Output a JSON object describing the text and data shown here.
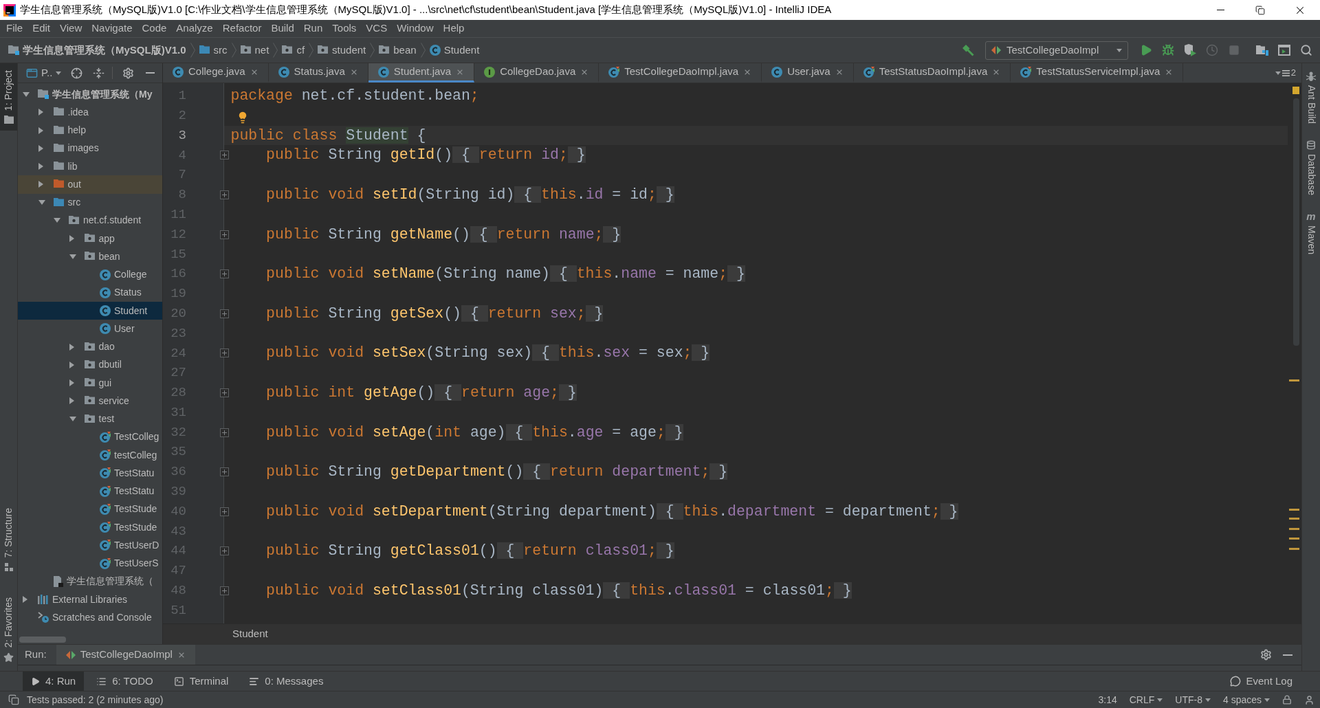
{
  "window": {
    "title": "学生信息管理系统（MySQL版)V1.0 [C:\\作业文档\\学生信息管理系统（MySQL版)V1.0] - ...\\src\\net\\cf\\student\\bean\\Student.java [学生信息管理系统（MySQL版)V1.0] - IntelliJ IDEA"
  },
  "menu": [
    "File",
    "Edit",
    "View",
    "Navigate",
    "Code",
    "Analyze",
    "Refactor",
    "Build",
    "Run",
    "Tools",
    "VCS",
    "Window",
    "Help"
  ],
  "navbar": {
    "breadcrumbs": [
      {
        "kind": "project",
        "label": "学生信息管理系统（MySQL版)V1.0"
      },
      {
        "kind": "source_folder",
        "label": "src"
      },
      {
        "kind": "package",
        "label": "net"
      },
      {
        "kind": "package",
        "label": "cf"
      },
      {
        "kind": "package",
        "label": "student"
      },
      {
        "kind": "package",
        "label": "bean"
      },
      {
        "kind": "class",
        "label": "Student"
      }
    ],
    "toolbar": [
      {
        "kind": "build",
        "disabled": false
      },
      {
        "kind": "run_config",
        "label": "TestCollegeDaoImpl"
      },
      {
        "kind": "run",
        "disabled": false
      },
      {
        "kind": "debug",
        "disabled": false
      },
      {
        "kind": "coverage",
        "disabled": false
      },
      {
        "kind": "profile",
        "disabled": true
      },
      {
        "kind": "stop",
        "disabled": true
      },
      {
        "kind": "project_structure",
        "disabled": false
      },
      {
        "kind": "layout",
        "disabled": false
      },
      {
        "kind": "search",
        "disabled": false
      }
    ]
  },
  "left_strip": {
    "top": [
      {
        "label": "1: Project",
        "kind": "project",
        "selected": true
      }
    ],
    "bottom": [
      {
        "label": "7: Structure",
        "kind": "structure",
        "selected": false
      },
      {
        "label": "2: Favorites",
        "kind": "favorites",
        "selected": false
      }
    ]
  },
  "project_panel": {
    "view": "P..",
    "tree": [
      {
        "label": "学生信息管理系统（My",
        "kind": "project",
        "expanded": true,
        "selected": false,
        "children": [
          {
            "label": ".idea",
            "kind": "folder",
            "expanded": false,
            "selected": false
          },
          {
            "label": "help",
            "kind": "folder",
            "expanded": false,
            "selected": false
          },
          {
            "label": "images",
            "kind": "folder",
            "expanded": false,
            "selected": false
          },
          {
            "label": "lib",
            "kind": "folder",
            "expanded": false,
            "selected": false
          },
          {
            "label": "out",
            "kind": "excluded_folder",
            "expanded": false,
            "selected": false
          },
          {
            "label": "src",
            "kind": "source_folder",
            "expanded": true,
            "selected": false,
            "children": [
              {
                "label": "net.cf.student",
                "kind": "package",
                "expanded": true,
                "selected": false,
                "children": [
                  {
                    "label": "app",
                    "kind": "package",
                    "expanded": false,
                    "selected": false
                  },
                  {
                    "label": "bean",
                    "kind": "package",
                    "expanded": true,
                    "selected": false,
                    "children": [
                      {
                        "label": "College",
                        "kind": "class",
                        "selected": false
                      },
                      {
                        "label": "Status",
                        "kind": "class",
                        "selected": false
                      },
                      {
                        "label": "Student",
                        "kind": "class",
                        "selected": true
                      },
                      {
                        "label": "User",
                        "kind": "class",
                        "selected": false
                      }
                    ]
                  },
                  {
                    "label": "dao",
                    "kind": "package",
                    "expanded": false,
                    "selected": false
                  },
                  {
                    "label": "dbutil",
                    "kind": "package",
                    "expanded": false,
                    "selected": false
                  },
                  {
                    "label": "gui",
                    "kind": "package",
                    "expanded": false,
                    "selected": false
                  },
                  {
                    "label": "service",
                    "kind": "package",
                    "expanded": false,
                    "selected": false
                  },
                  {
                    "label": "test",
                    "kind": "package",
                    "expanded": true,
                    "selected": false,
                    "children": [
                      {
                        "label": "TestColleg",
                        "kind": "test",
                        "selected": false
                      },
                      {
                        "label": "testColleg",
                        "kind": "test",
                        "selected": false
                      },
                      {
                        "label": "TestStatu",
                        "kind": "test",
                        "selected": false
                      },
                      {
                        "label": "TestStatu",
                        "kind": "test",
                        "selected": false
                      },
                      {
                        "label": "TestStude",
                        "kind": "test",
                        "selected": false
                      },
                      {
                        "label": "TestStude",
                        "kind": "test",
                        "selected": false
                      },
                      {
                        "label": "TestUserD",
                        "kind": "test",
                        "selected": false
                      },
                      {
                        "label": "TestUserS",
                        "kind": "test",
                        "selected": false
                      }
                    ]
                  }
                ]
              }
            ]
          },
          {
            "label": "学生信息管理系统（",
            "kind": "module_file",
            "selected": false
          }
        ]
      },
      {
        "label": "External Libraries",
        "kind": "libraries",
        "expanded": false,
        "selected": false
      },
      {
        "label": "Scratches and Console",
        "kind": "scratches",
        "selected": false
      }
    ]
  },
  "tabs": [
    {
      "label": "College.java",
      "kind": "class",
      "selected": false
    },
    {
      "label": "Status.java",
      "kind": "class",
      "selected": false
    },
    {
      "label": "Student.java",
      "kind": "class",
      "selected": true
    },
    {
      "label": "CollegeDao.java",
      "kind": "interface",
      "selected": false
    },
    {
      "label": "TestCollegeDaoImpl.java",
      "kind": "test",
      "selected": false
    },
    {
      "label": "User.java",
      "kind": "class",
      "selected": false
    },
    {
      "label": "TestStatusDaoImpl.java",
      "kind": "test",
      "selected": false
    },
    {
      "label": "TestStatusServiceImpl.java",
      "kind": "test",
      "selected": false
    }
  ],
  "hidden_tab_count": "2",
  "editor": {
    "lines": [
      {
        "number": "1",
        "current": false,
        "folded": false,
        "bulb": false,
        "tokens": [
          {
            "kind": "keyword",
            "text": "package "
          },
          {
            "kind": "plain",
            "text": "net.cf.student.bean"
          },
          {
            "kind": "keyword",
            "text": ";"
          }
        ]
      },
      {
        "number": "2",
        "current": false,
        "folded": false,
        "bulb": true
      },
      {
        "number": "3",
        "current": true,
        "folded": false,
        "bulb": false,
        "tokens": [
          {
            "kind": "keyword",
            "text": "public class "
          },
          {
            "kind": "usage",
            "text": "Student"
          },
          {
            "kind": "plain",
            "text": " {"
          }
        ]
      },
      {
        "number": "4",
        "current": false,
        "folded": true,
        "bulb": false,
        "tokens": [
          {
            "kind": "keyword",
            "text": "    public "
          },
          {
            "kind": "plain",
            "text": "String "
          },
          {
            "kind": "method",
            "text": "getId"
          },
          {
            "kind": "plain",
            "text": "()"
          },
          {
            "kind": "fold",
            "text": " { "
          },
          {
            "kind": "keyword",
            "text": "return "
          },
          {
            "kind": "field",
            "text": "id"
          },
          {
            "kind": "keyword",
            "text": ";"
          },
          {
            "kind": "fold",
            "text": " }"
          }
        ]
      },
      {
        "number": "7",
        "current": false,
        "folded": false,
        "bulb": false
      },
      {
        "number": "8",
        "current": false,
        "folded": true,
        "bulb": false,
        "tokens": [
          {
            "kind": "keyword",
            "text": "    public void "
          },
          {
            "kind": "method",
            "text": "setId"
          },
          {
            "kind": "plain",
            "text": "(String id)"
          },
          {
            "kind": "fold",
            "text": " { "
          },
          {
            "kind": "keyword",
            "text": "this"
          },
          {
            "kind": "plain",
            "text": "."
          },
          {
            "kind": "field",
            "text": "id"
          },
          {
            "kind": "plain",
            "text": " = id"
          },
          {
            "kind": "keyword",
            "text": ";"
          },
          {
            "kind": "fold",
            "text": " }"
          }
        ]
      },
      {
        "number": "11",
        "current": false,
        "folded": false,
        "bulb": false
      },
      {
        "number": "12",
        "current": false,
        "folded": true,
        "bulb": false,
        "tokens": [
          {
            "kind": "keyword",
            "text": "    public "
          },
          {
            "kind": "plain",
            "text": "String "
          },
          {
            "kind": "method",
            "text": "getName"
          },
          {
            "kind": "plain",
            "text": "()"
          },
          {
            "kind": "fold",
            "text": " { "
          },
          {
            "kind": "keyword",
            "text": "return "
          },
          {
            "kind": "field",
            "text": "name"
          },
          {
            "kind": "keyword",
            "text": ";"
          },
          {
            "kind": "fold",
            "text": " }"
          }
        ]
      },
      {
        "number": "15",
        "current": false,
        "folded": false,
        "bulb": false
      },
      {
        "number": "16",
        "current": false,
        "folded": true,
        "bulb": false,
        "tokens": [
          {
            "kind": "keyword",
            "text": "    public void "
          },
          {
            "kind": "method",
            "text": "setName"
          },
          {
            "kind": "plain",
            "text": "(String name)"
          },
          {
            "kind": "fold",
            "text": " { "
          },
          {
            "kind": "keyword",
            "text": "this"
          },
          {
            "kind": "plain",
            "text": "."
          },
          {
            "kind": "field",
            "text": "name"
          },
          {
            "kind": "plain",
            "text": " = name"
          },
          {
            "kind": "keyword",
            "text": ";"
          },
          {
            "kind": "fold",
            "text": " }"
          }
        ]
      },
      {
        "number": "19",
        "current": false,
        "folded": false,
        "bulb": false
      },
      {
        "number": "20",
        "current": false,
        "folded": true,
        "bulb": false,
        "tokens": [
          {
            "kind": "keyword",
            "text": "    public "
          },
          {
            "kind": "plain",
            "text": "String "
          },
          {
            "kind": "method",
            "text": "getSex"
          },
          {
            "kind": "plain",
            "text": "()"
          },
          {
            "kind": "fold",
            "text": " { "
          },
          {
            "kind": "keyword",
            "text": "return "
          },
          {
            "kind": "field",
            "text": "sex"
          },
          {
            "kind": "keyword",
            "text": ";"
          },
          {
            "kind": "fold",
            "text": " }"
          }
        ]
      },
      {
        "number": "23",
        "current": false,
        "folded": false,
        "bulb": false
      },
      {
        "number": "24",
        "current": false,
        "folded": true,
        "bulb": false,
        "tokens": [
          {
            "kind": "keyword",
            "text": "    public void "
          },
          {
            "kind": "method",
            "text": "setSex"
          },
          {
            "kind": "plain",
            "text": "(String sex)"
          },
          {
            "kind": "fold",
            "text": " { "
          },
          {
            "kind": "keyword",
            "text": "this"
          },
          {
            "kind": "plain",
            "text": "."
          },
          {
            "kind": "field",
            "text": "sex"
          },
          {
            "kind": "plain",
            "text": " = sex"
          },
          {
            "kind": "keyword",
            "text": ";"
          },
          {
            "kind": "fold",
            "text": " }"
          }
        ]
      },
      {
        "number": "27",
        "current": false,
        "folded": false,
        "bulb": false
      },
      {
        "number": "28",
        "current": false,
        "folded": true,
        "bulb": false,
        "tokens": [
          {
            "kind": "keyword",
            "text": "    public int "
          },
          {
            "kind": "method",
            "text": "getAge"
          },
          {
            "kind": "plain",
            "text": "()"
          },
          {
            "kind": "fold",
            "text": " { "
          },
          {
            "kind": "keyword",
            "text": "return "
          },
          {
            "kind": "field",
            "text": "age"
          },
          {
            "kind": "keyword",
            "text": ";"
          },
          {
            "kind": "fold",
            "text": " }"
          }
        ]
      },
      {
        "number": "31",
        "current": false,
        "folded": false,
        "bulb": false
      },
      {
        "number": "32",
        "current": false,
        "folded": true,
        "bulb": false,
        "tokens": [
          {
            "kind": "keyword",
            "text": "    public void "
          },
          {
            "kind": "method",
            "text": "setAge"
          },
          {
            "kind": "plain",
            "text": "("
          },
          {
            "kind": "keyword",
            "text": "int"
          },
          {
            "kind": "plain",
            "text": " age)"
          },
          {
            "kind": "fold",
            "text": " { "
          },
          {
            "kind": "keyword",
            "text": "this"
          },
          {
            "kind": "plain",
            "text": "."
          },
          {
            "kind": "field",
            "text": "age"
          },
          {
            "kind": "plain",
            "text": " = age"
          },
          {
            "kind": "keyword",
            "text": ";"
          },
          {
            "kind": "fold",
            "text": " }"
          }
        ]
      },
      {
        "number": "35",
        "current": false,
        "folded": false,
        "bulb": false
      },
      {
        "number": "36",
        "current": false,
        "folded": true,
        "bulb": false,
        "tokens": [
          {
            "kind": "keyword",
            "text": "    public "
          },
          {
            "kind": "plain",
            "text": "String "
          },
          {
            "kind": "method",
            "text": "getDepartment"
          },
          {
            "kind": "plain",
            "text": "()"
          },
          {
            "kind": "fold",
            "text": " { "
          },
          {
            "kind": "keyword",
            "text": "return "
          },
          {
            "kind": "field",
            "text": "department"
          },
          {
            "kind": "keyword",
            "text": ";"
          },
          {
            "kind": "fold",
            "text": " }"
          }
        ]
      },
      {
        "number": "39",
        "current": false,
        "folded": false,
        "bulb": false
      },
      {
        "number": "40",
        "current": false,
        "folded": true,
        "bulb": false,
        "tokens": [
          {
            "kind": "keyword",
            "text": "    public void "
          },
          {
            "kind": "method",
            "text": "setDepartment"
          },
          {
            "kind": "plain",
            "text": "(String department)"
          },
          {
            "kind": "fold",
            "text": " { "
          },
          {
            "kind": "keyword",
            "text": "this"
          },
          {
            "kind": "plain",
            "text": "."
          },
          {
            "kind": "field",
            "text": "department"
          },
          {
            "kind": "plain",
            "text": " = department"
          },
          {
            "kind": "keyword",
            "text": ";"
          },
          {
            "kind": "fold",
            "text": " }"
          }
        ]
      },
      {
        "number": "43",
        "current": false,
        "folded": false,
        "bulb": false
      },
      {
        "number": "44",
        "current": false,
        "folded": true,
        "bulb": false,
        "tokens": [
          {
            "kind": "keyword",
            "text": "    public "
          },
          {
            "kind": "plain",
            "text": "String "
          },
          {
            "kind": "method",
            "text": "getClass01"
          },
          {
            "kind": "plain",
            "text": "()"
          },
          {
            "kind": "fold",
            "text": " { "
          },
          {
            "kind": "keyword",
            "text": "return "
          },
          {
            "kind": "field",
            "text": "class01"
          },
          {
            "kind": "keyword",
            "text": ";"
          },
          {
            "kind": "fold",
            "text": " }"
          }
        ]
      },
      {
        "number": "47",
        "current": false,
        "folded": false,
        "bulb": false
      },
      {
        "number": "48",
        "current": false,
        "folded": true,
        "bulb": false,
        "tokens": [
          {
            "kind": "keyword",
            "text": "    public void "
          },
          {
            "kind": "method",
            "text": "setClass01"
          },
          {
            "kind": "plain",
            "text": "(String class01)"
          },
          {
            "kind": "fold",
            "text": " { "
          },
          {
            "kind": "keyword",
            "text": "this"
          },
          {
            "kind": "plain",
            "text": "."
          },
          {
            "kind": "field",
            "text": "class01"
          },
          {
            "kind": "plain",
            "text": " = class01"
          },
          {
            "kind": "keyword",
            "text": ";"
          },
          {
            "kind": "fold",
            "text": " }"
          }
        ]
      },
      {
        "number": "51",
        "current": false,
        "folded": false,
        "bulb": false
      }
    ],
    "breadcrumb": "Student"
  },
  "right_strip": [
    {
      "label": "Ant Build",
      "kind": "ant"
    },
    {
      "label": "Database",
      "kind": "database"
    },
    {
      "label": "Maven",
      "kind": "maven",
      "icon_text": "m"
    }
  ],
  "run_panel": {
    "title": "Run:",
    "tab": "TestCollegeDaoImpl"
  },
  "bottom_bar": {
    "tools": [
      {
        "label": "4: Run",
        "kind": "run",
        "selected": true
      },
      {
        "label": "6: TODO",
        "kind": "todo",
        "selected": false
      },
      {
        "label": "Terminal",
        "kind": "terminal",
        "selected": false
      },
      {
        "label": "0: Messages",
        "kind": "messages",
        "selected": false
      }
    ],
    "event_log": "Event Log"
  },
  "status_bar": {
    "message": "Tests passed: 2 (2 minutes ago)",
    "widgets": [
      {
        "text": "3:14",
        "dropdown": false
      },
      {
        "text": "CRLF",
        "dropdown": true
      },
      {
        "text": "UTF-8",
        "dropdown": true
      },
      {
        "text": "4 spaces",
        "dropdown": true
      }
    ]
  }
}
